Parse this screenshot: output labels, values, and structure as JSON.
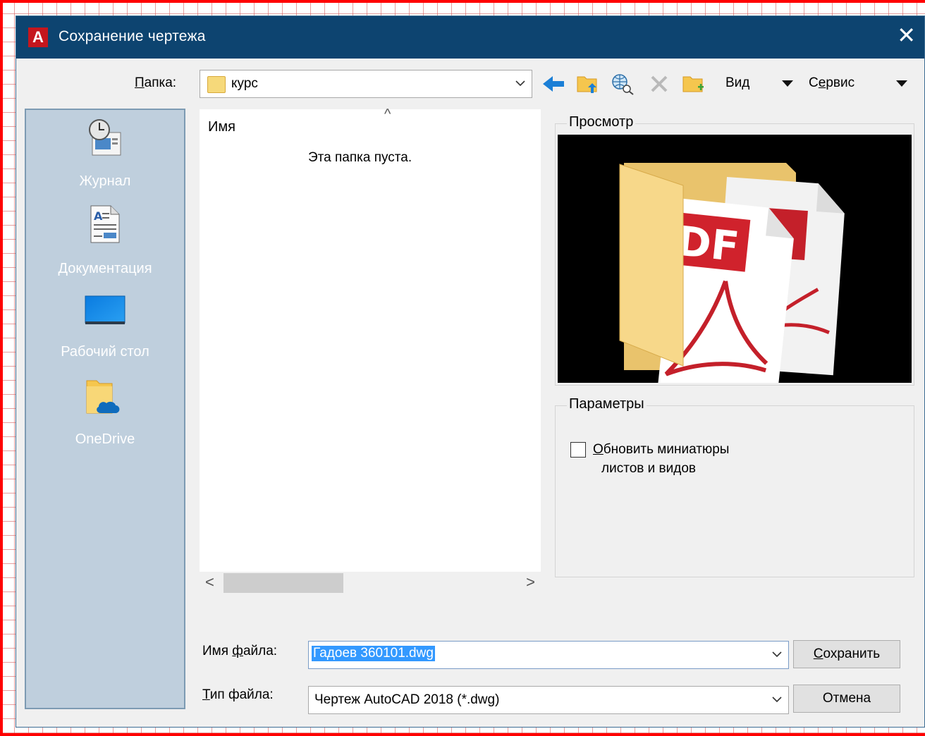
{
  "window": {
    "title": "Сохранение чертежа",
    "close_glyph": "✕",
    "logo_letter": "A"
  },
  "toolbar": {
    "folder_label": "Папка:",
    "folder_label_hotkey": "П",
    "folder_label_rest": "апка:",
    "folder_value": "курс",
    "view_label_pre": "Ви",
    "view_label_hotkey": "д",
    "service_label_pre": "С",
    "service_label_hotkey": "е",
    "service_label_rest": "рвис"
  },
  "places": [
    {
      "label": "Журнал",
      "icon": "history-icon"
    },
    {
      "label": "Документация",
      "icon": "documents-icon"
    },
    {
      "label": "Рабочий стол",
      "icon": "desktop-icon"
    },
    {
      "label": "OneDrive",
      "icon": "onedrive-icon"
    }
  ],
  "file_list": {
    "column_name": "Имя",
    "empty_message": "Эта папка пуста.",
    "sort_glyph": "^",
    "scroll_left": "<",
    "scroll_right": ">"
  },
  "preview": {
    "title": "Просмотр",
    "image_text": "DF"
  },
  "options": {
    "title": "Параметры",
    "checkbox_hotkey": "О",
    "checkbox_line1_rest": "бновить миниатюры",
    "checkbox_line2": "листов и видов",
    "checked": false
  },
  "filename": {
    "label_pre": "Имя ",
    "label_hotkey": "ф",
    "label_rest": "айла:",
    "value": "Гадоев 360101.dwg"
  },
  "filetype": {
    "label_hotkey": "Т",
    "label_rest": "ип файла:",
    "value": "Чертеж AutoCAD 2018 (*.dwg)"
  },
  "buttons": {
    "save_hotkey": "С",
    "save_rest": "охранить",
    "cancel": "Отмена"
  },
  "colors": {
    "titlebar": "#0d4470",
    "places_bg": "#bfcfdd",
    "accent_blue": "#0078d7",
    "selection": "#3399ff"
  }
}
